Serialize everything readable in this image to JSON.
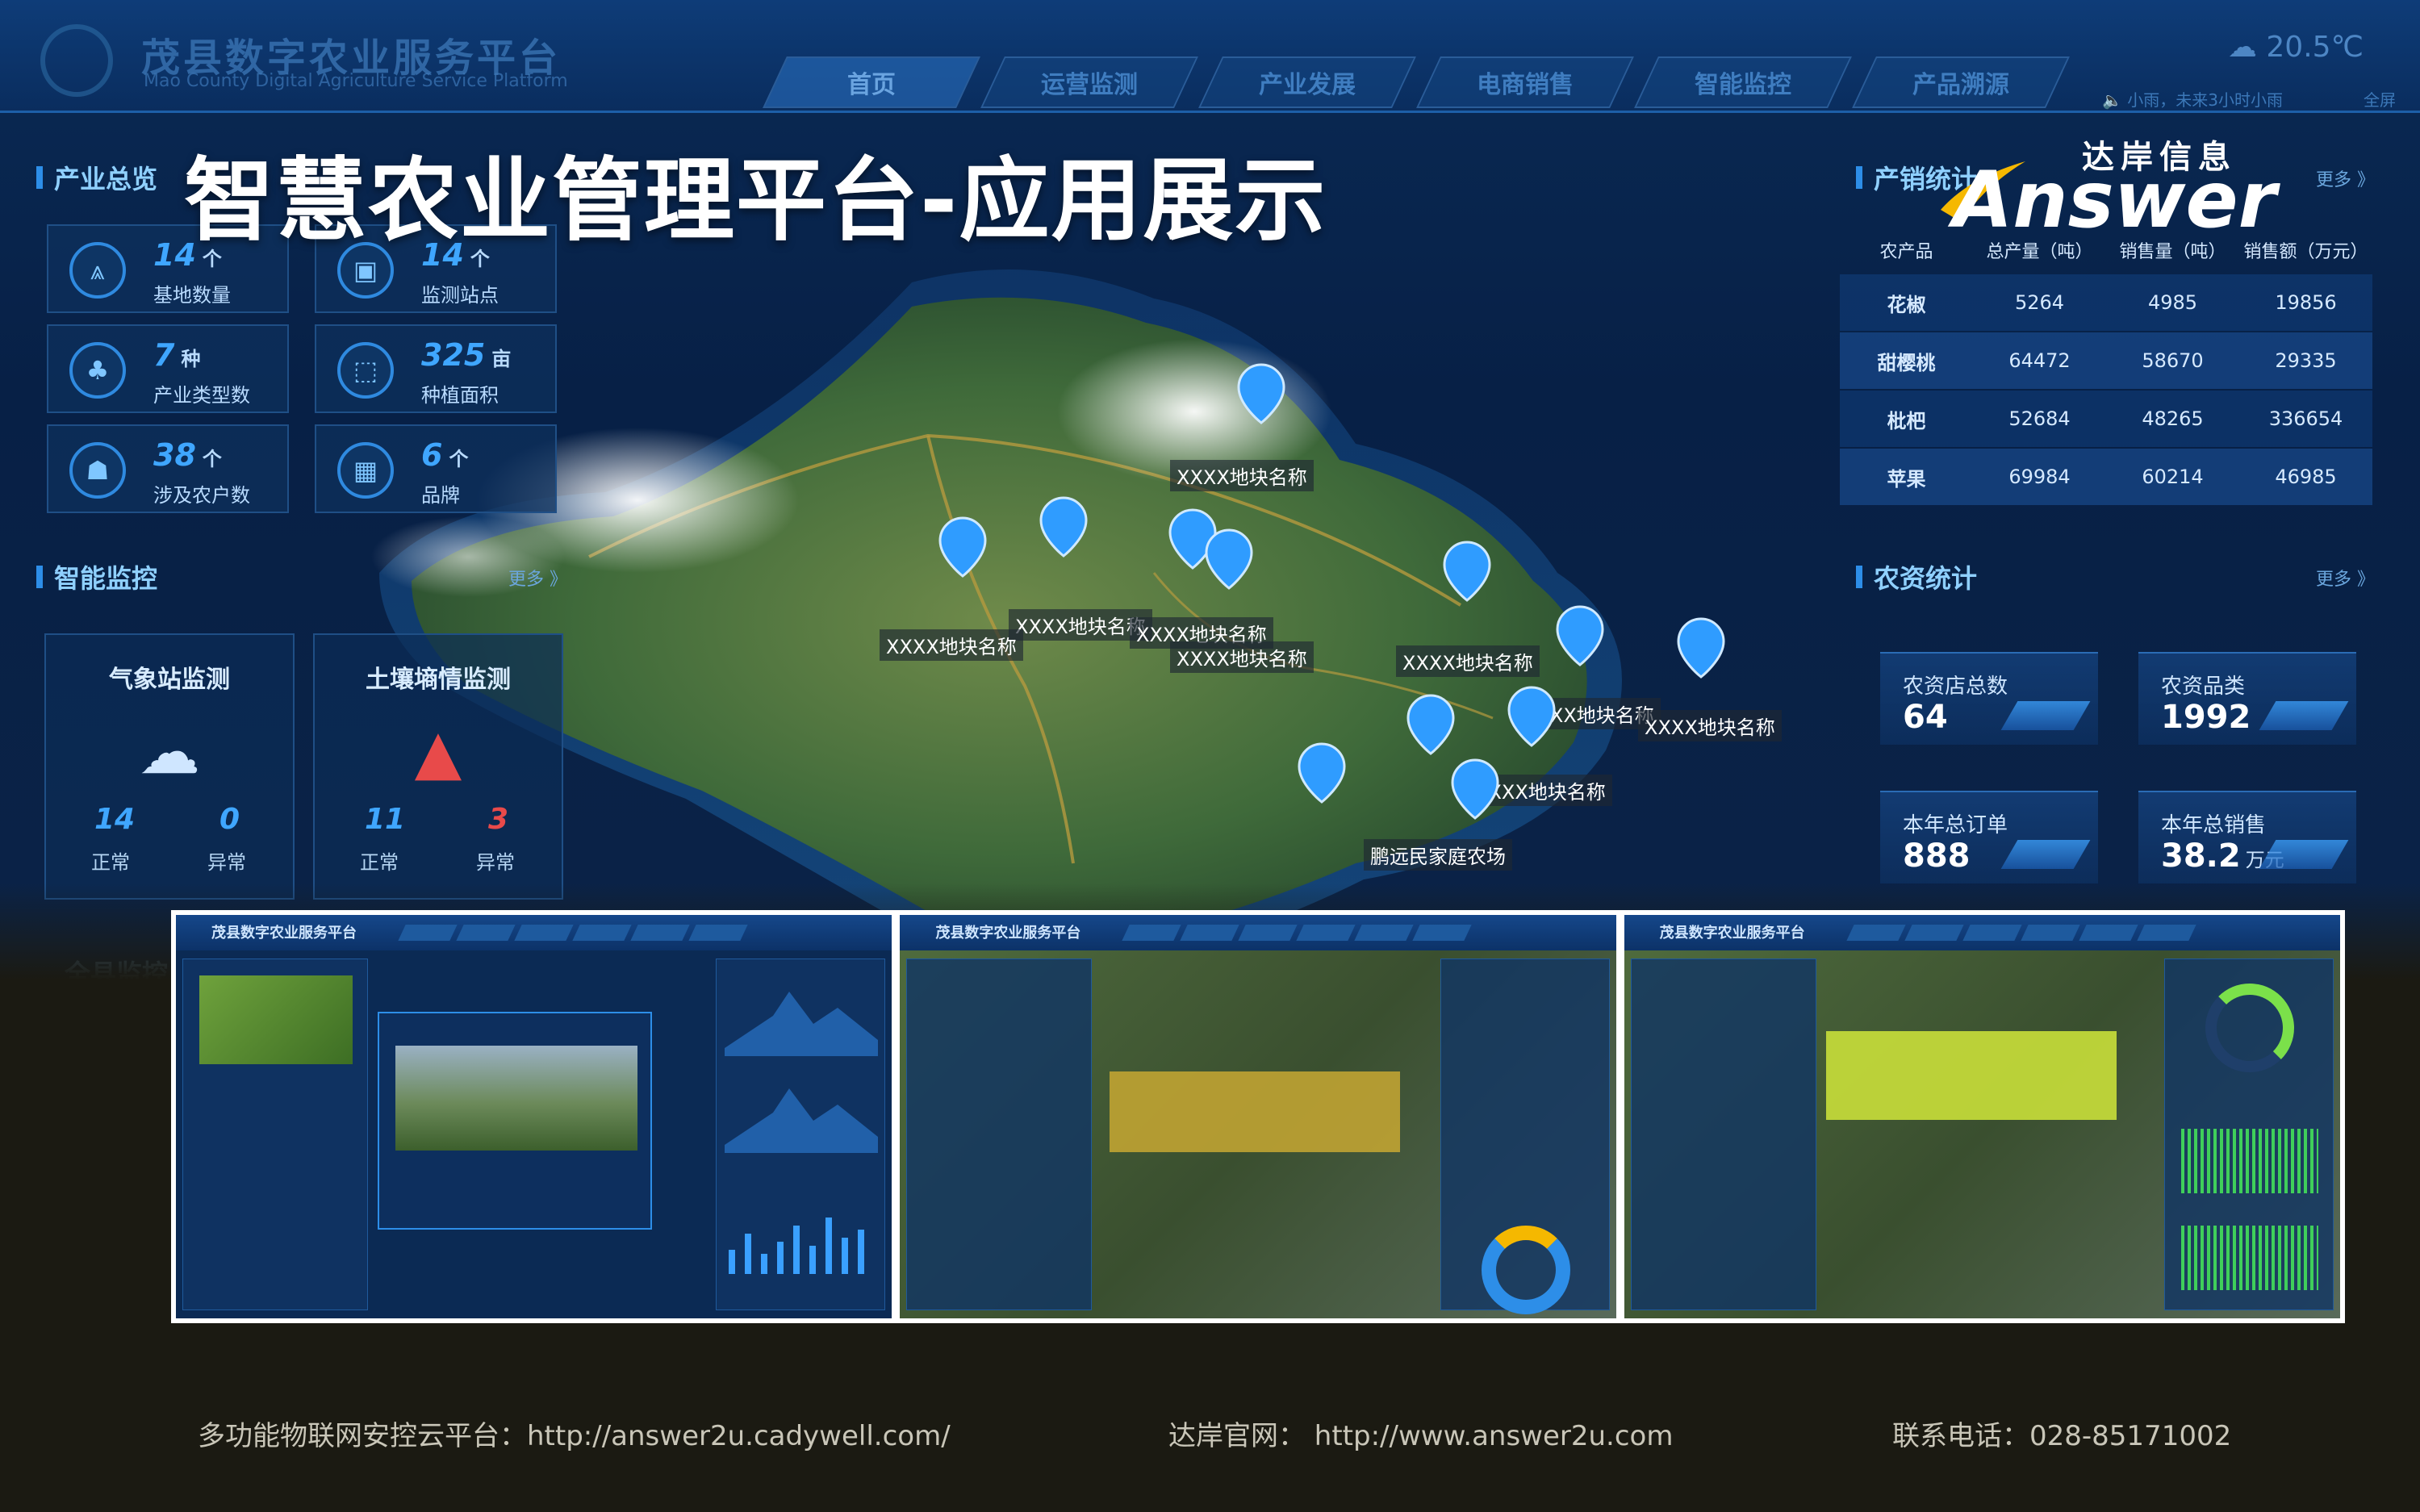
{
  "header": {
    "system_title": "茂县数字农业服务平台",
    "system_subtitle": "Mao County Digital Agriculture Service Platform",
    "nav": [
      "首页",
      "运营监测",
      "产业发展",
      "电商销售",
      "智能监控",
      "产品溯源"
    ],
    "weather_temp": "20.5℃",
    "weather_note": "小雨，未来3小时小雨",
    "weather_more": "全屏"
  },
  "banner": {
    "title": "智慧农业管理平台-应用展示",
    "brand_cn": "达岸信息",
    "brand_en": "Answer"
  },
  "left": {
    "overview_title": "产业总览",
    "stats": [
      {
        "num": "14",
        "unit": "个",
        "label": "基地数量",
        "icon": "seedling-icon"
      },
      {
        "num": "14",
        "unit": "个",
        "label": "监测站点",
        "icon": "monitor-icon"
      },
      {
        "num": "7",
        "unit": "种",
        "label": "产业类型数",
        "icon": "fruit-icon"
      },
      {
        "num": "325",
        "unit": "亩",
        "label": "种植面积",
        "icon": "area-icon"
      },
      {
        "num": "38",
        "unit": "个",
        "label": "涉及农户数",
        "icon": "farmer-icon"
      },
      {
        "num": "6",
        "unit": "个",
        "label": "品牌",
        "icon": "brand-icon"
      }
    ],
    "monitor_title": "智能监控",
    "monitor_more": "更多 》",
    "weather_station": {
      "title": "气象站监测",
      "normal": "14",
      "abnormal": "0",
      "normal_label": "正常",
      "abnormal_label": "异常"
    },
    "soil_station": {
      "title": "土壤墒情监测",
      "normal": "11",
      "abnormal": "3",
      "normal_label": "正常",
      "abnormal_label": "异常"
    },
    "bottom_title": "全县监控"
  },
  "right": {
    "sales_title": "产销统计",
    "sales_more": "更多 》",
    "sales_headers": [
      "农产品",
      "总产量（吨）",
      "销售量（吨）",
      "销售额（万元）"
    ],
    "sales_rows": [
      [
        "花椒",
        "5264",
        "4985",
        "19856"
      ],
      [
        "甜樱桃",
        "64472",
        "58670",
        "29335"
      ],
      [
        "枇杷",
        "52684",
        "48265",
        "336654"
      ],
      [
        "苹果",
        "69984",
        "60214",
        "46985"
      ]
    ],
    "supply_title": "农资统计",
    "supply_more": "更多 》",
    "supply": [
      {
        "label": "农资店总数",
        "value": "64",
        "unit": ""
      },
      {
        "label": "农资品类",
        "value": "1992",
        "unit": ""
      },
      {
        "label": "本年总订单",
        "value": "888",
        "unit": ""
      },
      {
        "label": "本年总销售",
        "value": "38.2",
        "unit": "万元"
      }
    ]
  },
  "map": {
    "plot_label": "XXXX地块名称",
    "farm_label": "鹏远民家庭农场"
  },
  "shots": {
    "title": "茂县数字农业服务平台"
  },
  "footer": {
    "cloud": "多功能物联网安控云平台：http://answer2u.cadywell.com/",
    "site": "达岸官网： http://www.answer2u.com",
    "phone": "联系电话：028-85171002"
  },
  "colors": {
    "accent": "#2d8ee8",
    "brand_yellow": "#f5b800",
    "warn_red": "#e84a4a"
  }
}
